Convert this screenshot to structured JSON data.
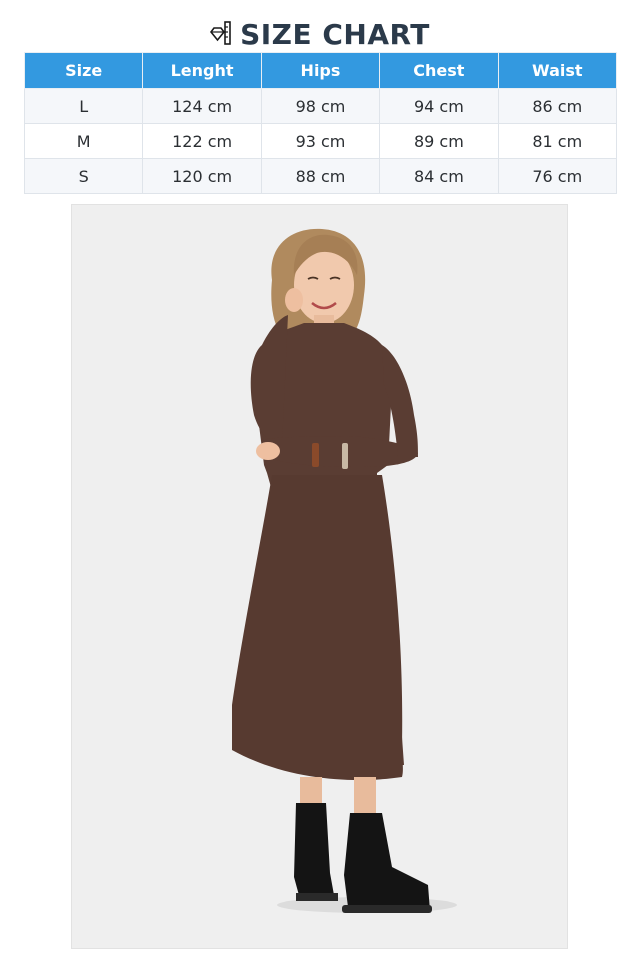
{
  "title": {
    "icon": "diamond-ruler-icon",
    "text": "SIZE CHART"
  },
  "table": {
    "headers": [
      "Size",
      "Lenght",
      "Hips",
      "Chest",
      "Waist"
    ],
    "rows": [
      [
        "L",
        "124 cm",
        "98 cm",
        "94 cm",
        "86 cm"
      ],
      [
        "M",
        "122 cm",
        "93 cm",
        "89 cm",
        "81 cm"
      ],
      [
        "S",
        "120 cm",
        "88 cm",
        "84 cm",
        "76 cm"
      ]
    ]
  },
  "colors": {
    "header_bg": "#3399e0",
    "title_text": "#2b3a4a",
    "dress": "#5a3d33",
    "photo_bg": "#efefef"
  }
}
